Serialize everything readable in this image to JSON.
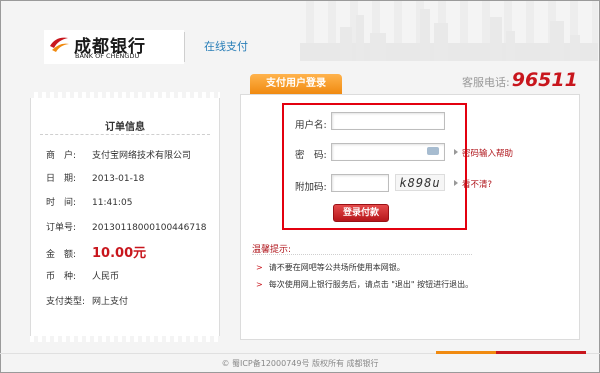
{
  "header": {
    "bank_cn": "成都银行",
    "bank_en": "BANK OF CHENGDU",
    "online_pay": "在线支付",
    "hotline_label": "客服电话:",
    "hotline_number": "96511"
  },
  "order": {
    "title": "订单信息",
    "rows": [
      {
        "label": "商　户:",
        "value": "支付宝网络技术有限公司"
      },
      {
        "label": "日　期:",
        "value": "2013-01-18"
      },
      {
        "label": "时　间:",
        "value": "11:41:05"
      },
      {
        "label": "订单号:",
        "value": "20130118000100446718"
      },
      {
        "label": "金　额:",
        "value": "10.00元"
      },
      {
        "label": "币　种:",
        "value": "人民币"
      },
      {
        "label": "支付类型:",
        "value": "网上支付"
      }
    ]
  },
  "login": {
    "tab_label": "支付用户登录",
    "username_label": "用户名:",
    "username_value": "",
    "password_label": "密　码:",
    "password_value": "",
    "password_help": "密码输入帮助",
    "captcha_label": "附加码:",
    "captcha_value": "",
    "captcha_image_text": "k898u",
    "captcha_refresh": "看不清?",
    "submit_label": "登录付款"
  },
  "tips": {
    "title": "温馨提示:",
    "items": [
      "请不要在网吧等公共场所使用本网银。",
      "每次使用网上银行服务后，请点击 \"退出\" 按钮进行退出。"
    ]
  },
  "footer": {
    "text": "© 蜀ICP备12000749号  版权所有 成都银行"
  },
  "colors": {
    "brand_red": "#c8161d",
    "tab_orange": "#f08a10",
    "highlight_box": "#e3000f",
    "link_blue": "#2a7fb8"
  }
}
